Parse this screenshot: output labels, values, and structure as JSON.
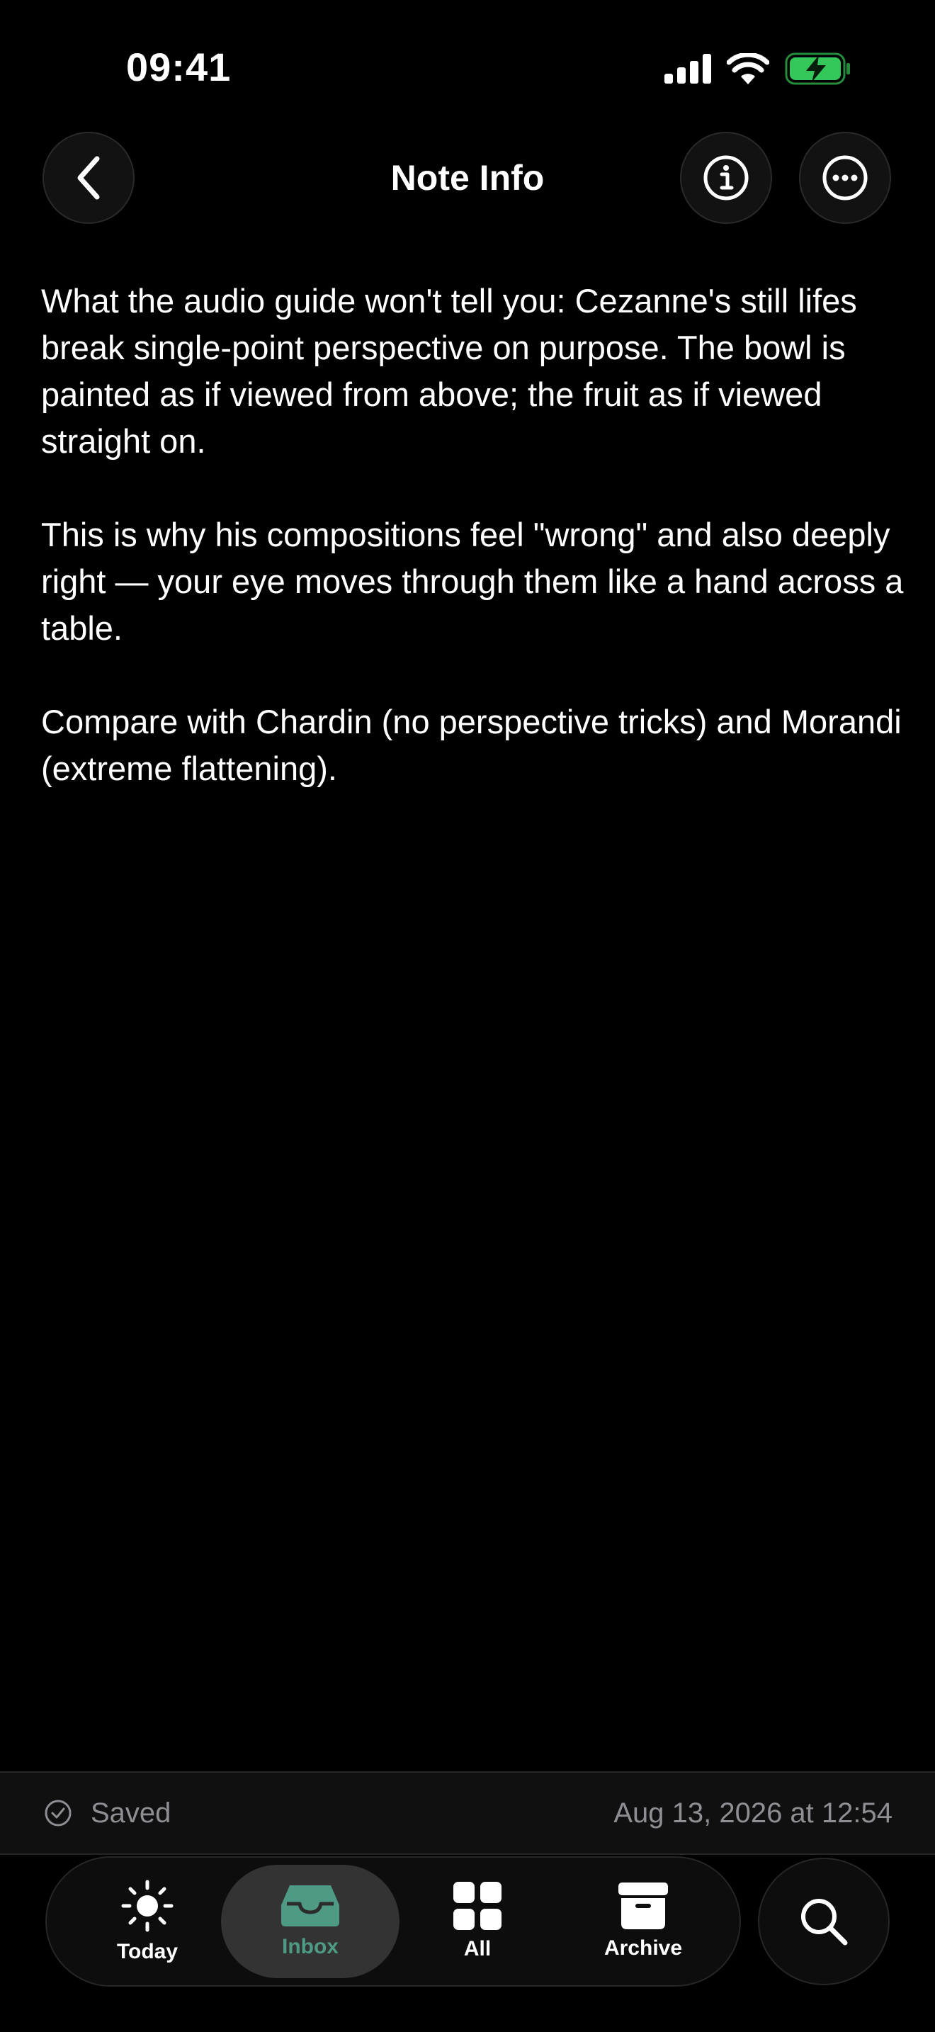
{
  "status_bar": {
    "time": "09:41"
  },
  "header": {
    "title": "Note Info",
    "back_icon": "chevron-left-icon",
    "info_icon": "info-circle-icon",
    "more_icon": "ellipsis-circle-icon"
  },
  "note": {
    "paragraphs": [
      "What the audio guide won't tell you: Cezanne's still lifes break single-point perspective on purpose. The bowl is painted as if viewed from above; the fruit as if viewed straight on.",
      "This is why his compositions feel \"wrong\" and also deeply right — your eye moves through them like a hand across a table.",
      "Compare with Chardin (no perspective tricks) and Morandi (extreme flattening)."
    ]
  },
  "save_status": {
    "label": "Saved",
    "timestamp": "Aug 13, 2026 at 12:54",
    "icon": "check-circle-icon"
  },
  "tab_bar": {
    "tabs": [
      {
        "label": "Today",
        "icon": "sun-icon",
        "active": false
      },
      {
        "label": "Inbox",
        "icon": "inbox-tray-icon",
        "active": true
      },
      {
        "label": "All",
        "icon": "grid-icon",
        "active": false
      },
      {
        "label": "Archive",
        "icon": "archive-box-icon",
        "active": false
      }
    ],
    "search_icon": "search-icon"
  },
  "colors": {
    "background": "#000000",
    "accent": "#4e9a84",
    "battery_green": "#34c759",
    "secondary_text": "#8e8e93"
  }
}
